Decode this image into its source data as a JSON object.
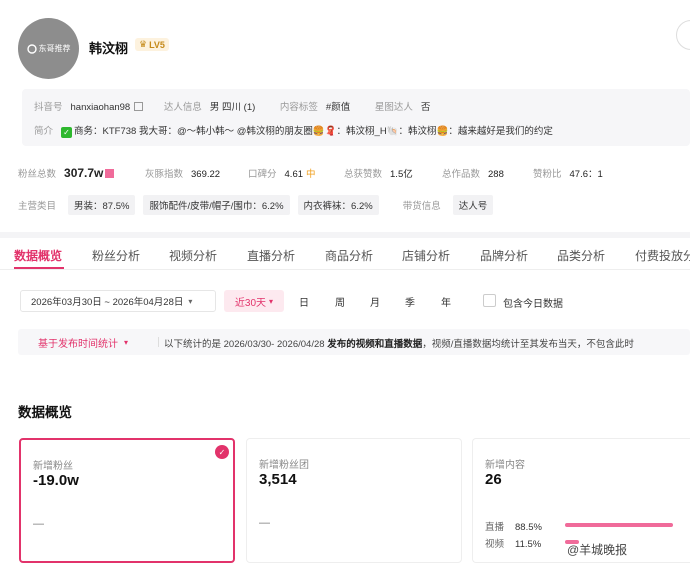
{
  "profile": {
    "avatar_text": "东哥推荐",
    "name": "韩汶栩",
    "level": "LV5",
    "fields": [
      {
        "label": "抖音号",
        "value": "hanxiaohan98"
      },
      {
        "label": "达人信息",
        "value": "男 四川 (1)"
      },
      {
        "label": "内容标签",
        "value": "#颜值"
      },
      {
        "label": "星图达人",
        "value": "否"
      }
    ],
    "bio_label": "简介",
    "bio": "商务：KTF738 我大哥：@～韩小韩～ @韩汶栩的朋友圈🍔🧣：韩汶栩_H🐚：韩汶栩🍔：越来越好是我们的约定"
  },
  "stats": [
    {
      "label": "粉丝总数",
      "value": "307.7w"
    },
    {
      "label": "灰豚指数",
      "value": "369.22"
    },
    {
      "label": "口碑分",
      "value": "4.61",
      "badge": "中"
    },
    {
      "label": "总获赞数",
      "value": "1.5亿"
    },
    {
      "label": "总作品数",
      "value": "288"
    },
    {
      "label": "赞粉比",
      "value": "47.6：1"
    }
  ],
  "categories": {
    "label": "主营类目",
    "items": [
      "男装：87.5%",
      "服饰配件/皮带/帽子/围巾：6.2%",
      "内衣裤袜：6.2%"
    ],
    "goods_label": "带货信息",
    "goods_value": "达人号"
  },
  "tabs": [
    "数据概览",
    "粉丝分析",
    "视频分析",
    "直播分析",
    "商品分析",
    "店铺分析",
    "品牌分析",
    "品类分析",
    "付费投放分"
  ],
  "filters": {
    "date_range": "2026年03月30日 ~ 2026年04月28日",
    "periods": [
      "近30天",
      "日",
      "周",
      "月",
      "季",
      "年"
    ],
    "include_today": "包含今日数据"
  },
  "notice": {
    "button": "基于发布时间统计",
    "text_prefix": "以下统计的是 2026/03/30- 2026/04/28 ",
    "text_bold": "发布的视频和直播数据",
    "text_suffix": "，视频/直播数据均统计至其发布当天，不包含此时"
  },
  "overview": {
    "title": "数据概览",
    "cards": [
      {
        "label": "新增粉丝",
        "value": "-19.0w",
        "sub": "—"
      },
      {
        "label": "新增粉丝团",
        "value": "3,514",
        "sub": "—"
      },
      {
        "label": "新增内容",
        "value": "26"
      }
    ],
    "breakdown": [
      {
        "label": "直播",
        "percent": "88.5%",
        "fraction": 0.885
      },
      {
        "label": "视频",
        "percent": "11.5%",
        "fraction": 0.115
      }
    ]
  },
  "watermark": "@羊城晚报",
  "colors": {
    "accent": "#e2336b",
    "bar": "#f06b9a",
    "level": "#c58a1a"
  }
}
